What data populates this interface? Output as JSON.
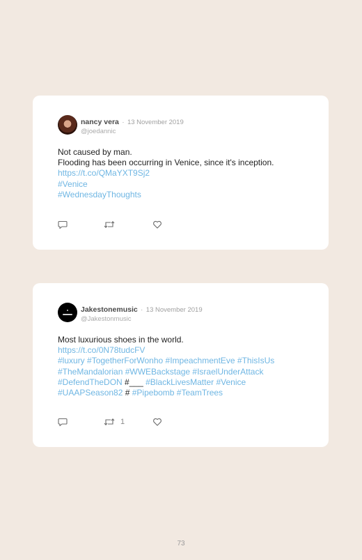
{
  "tweets": [
    {
      "name": "nancy vera",
      "separator": "·",
      "date": "13 November 2019",
      "handle": "@joedannic",
      "lines": [
        [
          {
            "text": "Not caused by man.",
            "kind": "plain"
          }
        ],
        [
          {
            "text": "Flooding has been occurring in Venice, since it's inception.",
            "kind": "plain"
          }
        ],
        [
          {
            "text": "https://t.co/QMaYXT9Sj2",
            "kind": "link"
          }
        ],
        [
          {
            "text": "#Venice",
            "kind": "link"
          }
        ],
        [
          {
            "text": "#WednesdayThoughts",
            "kind": "link"
          }
        ]
      ],
      "retweet_count": ""
    },
    {
      "name": "Jakestonemusic",
      "separator": "·",
      "date": "13 November 2019",
      "handle": "@Jakestonmusic",
      "lines": [
        [
          {
            "text": "Most luxurious shoes in the world.",
            "kind": "plain"
          }
        ],
        [
          {
            "text": "https://t.co/0N78tudcFV",
            "kind": "link"
          }
        ],
        [
          {
            "text": "#luxury #TogetherForWonho #ImpeachmentEve #ThisIsUs",
            "kind": "link"
          }
        ],
        [
          {
            "text": "#TheMandalorian #WWEBackstage #IsraelUnderAttack",
            "kind": "link"
          }
        ],
        [
          {
            "text": "#DefendTheDON ",
            "kind": "link"
          },
          {
            "text": "#___",
            "kind": "plain"
          },
          {
            "text": " #BlackLivesMatter #Venice",
            "kind": "link"
          }
        ],
        [
          {
            "text": "#UAAPSeason82 ",
            "kind": "link"
          },
          {
            "text": "#",
            "kind": "plain"
          },
          {
            "text": " #Pipebomb #TeamTrees",
            "kind": "link"
          }
        ]
      ],
      "retweet_count": "1"
    }
  ],
  "page_number": "73",
  "icons": {
    "reply": "reply-icon",
    "retweet": "retweet-icon",
    "like": "like-icon"
  },
  "colors": {
    "background": "#f2e9e1",
    "card": "#ffffff",
    "link": "#6fb6e3",
    "text": "#222222",
    "muted": "#a0a0a0"
  }
}
